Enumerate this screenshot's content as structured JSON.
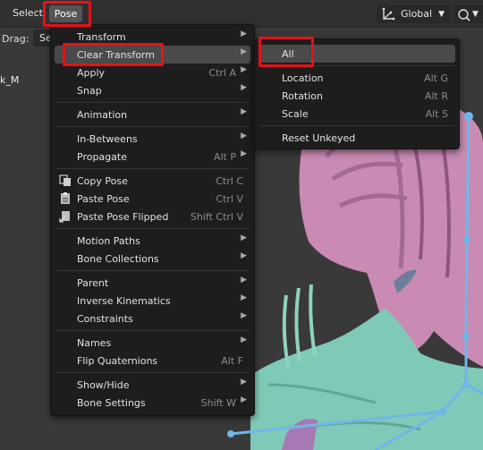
{
  "header": {
    "select_label": "Select",
    "pose_label": "Pose",
    "orientation": {
      "label": "Global",
      "icon": "transform-orientation-icon"
    },
    "snap_icon": "snap-icon"
  },
  "toolbar": {
    "drag_label": "Drag:",
    "drag_value": "Se"
  },
  "viewport": {
    "object_name": "k_M"
  },
  "pose_menu": {
    "items": [
      {
        "label": "Transform",
        "submenu": true
      },
      {
        "label": "Clear Transform",
        "submenu": true,
        "highlighted": true
      },
      {
        "label": "Apply",
        "shortcut": "Ctrl A",
        "submenu": true
      },
      {
        "label": "Snap",
        "submenu": true
      },
      {
        "label": "Animation",
        "submenu": true
      },
      {
        "label": "In-Betweens",
        "submenu": true
      },
      {
        "label": "Propagate",
        "shortcut": "Alt P",
        "submenu": true
      },
      {
        "label": "Copy Pose",
        "shortcut": "Ctrl C",
        "icon": "copy-pose-icon"
      },
      {
        "label": "Paste Pose",
        "shortcut": "Ctrl V",
        "icon": "paste-pose-icon"
      },
      {
        "label": "Paste Pose Flipped",
        "shortcut": "Shift Ctrl V",
        "icon": "paste-flipped-icon"
      },
      {
        "label": "Motion Paths",
        "submenu": true
      },
      {
        "label": "Bone Collections",
        "submenu": true
      },
      {
        "label": "Parent",
        "submenu": true
      },
      {
        "label": "Inverse Kinematics",
        "submenu": true
      },
      {
        "label": "Constraints",
        "submenu": true
      },
      {
        "label": "Names",
        "submenu": true
      },
      {
        "label": "Flip Quaternions",
        "shortcut": "Alt F"
      },
      {
        "label": "Show/Hide",
        "submenu": true
      },
      {
        "label": "Bone Settings",
        "shortcut": "Shift W",
        "submenu": true
      }
    ]
  },
  "clear_transform_menu": {
    "items": [
      {
        "label": "All",
        "highlighted": true
      },
      {
        "label": "Location",
        "shortcut": "Alt G"
      },
      {
        "label": "Rotation",
        "shortcut": "Alt R"
      },
      {
        "label": "Scale",
        "shortcut": "Alt S"
      },
      {
        "label": "Reset Unkeyed"
      }
    ]
  },
  "colors": {
    "highlight_box": "#e8101a",
    "menu_bg": "#1d1d1d",
    "menu_hover": "#4a4a4a",
    "bone_blue": "#6fb7e8",
    "mesh_pink": "#c98ab3",
    "mesh_teal": "#7fc9b8"
  }
}
